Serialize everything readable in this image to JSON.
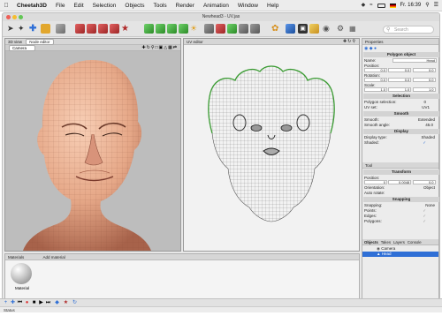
{
  "menubar": {
    "apple": "",
    "items": [
      "Cheetah3D",
      "File",
      "Edit",
      "Selection",
      "Objects",
      "Tools",
      "Render",
      "Animation",
      "Window",
      "Help"
    ],
    "clock": "Fr. 16:39"
  },
  "window": {
    "title": "Newhead3 - UV.jas"
  },
  "toolbar": {
    "search_placeholder": "Search"
  },
  "view3d": {
    "header_label": "3D view",
    "tab_label": "Node editor",
    "camera_select": "Camera"
  },
  "uvview": {
    "header_label": "UV editor"
  },
  "properties": {
    "header_label": "Properties",
    "section_polygon": "Polygon object",
    "name_label": "Name:",
    "name_value": "Head",
    "position_label": "Position:",
    "position_values": [
      "0.0",
      "0.0",
      "0.0"
    ],
    "rotation_label": "Rotation:",
    "rotation_values": [
      "0.0",
      "0.0",
      "0.0"
    ],
    "scale_label": "Scale:",
    "scale_values": [
      "1.0",
      "1.0",
      "1.0"
    ],
    "section_selection": "Selection",
    "poly_sel_label": "Polygon selection:",
    "poly_sel_value": "0",
    "uv_set_label": "UV set:",
    "uv_set_value": "UV1",
    "section_smooth": "Smooth",
    "smooth_label": "Smooth:",
    "smooth_value": "Extended",
    "smooth_angle_label": "Smooth angle:",
    "smooth_angle_value": "45.0",
    "section_display": "Display",
    "display_type_label": "Display type:",
    "display_type_value": "Shaded",
    "shaded_label": "Shaded:"
  },
  "tool": {
    "header_label": "Tool",
    "section_transform": "Transform",
    "position_label": "Position:",
    "position_values": [
      "0",
      "0.0048",
      "0.0"
    ],
    "orientation_label": "Orientation:",
    "orientation_value": "Object",
    "autorotate_label": "Auto rotate:",
    "section_snapping": "Snapping",
    "snapping_label": "Snapping:",
    "snapping_value": "None",
    "points_label": "Points:",
    "edges_label": "Edges:",
    "polygons_label": "Polygons:"
  },
  "objects": {
    "tabs": [
      "Objects",
      "Takes",
      "Layers",
      "Console"
    ],
    "items": [
      "Camera",
      "Head"
    ]
  },
  "materials": {
    "header_label": "Materials",
    "header_tab": "Add material",
    "material_name": "Material"
  },
  "status": {
    "text": "Status"
  },
  "colors": {
    "accent": "#2f6fd6",
    "skin": "#e6a888",
    "uv_green": "#3a9b32"
  }
}
